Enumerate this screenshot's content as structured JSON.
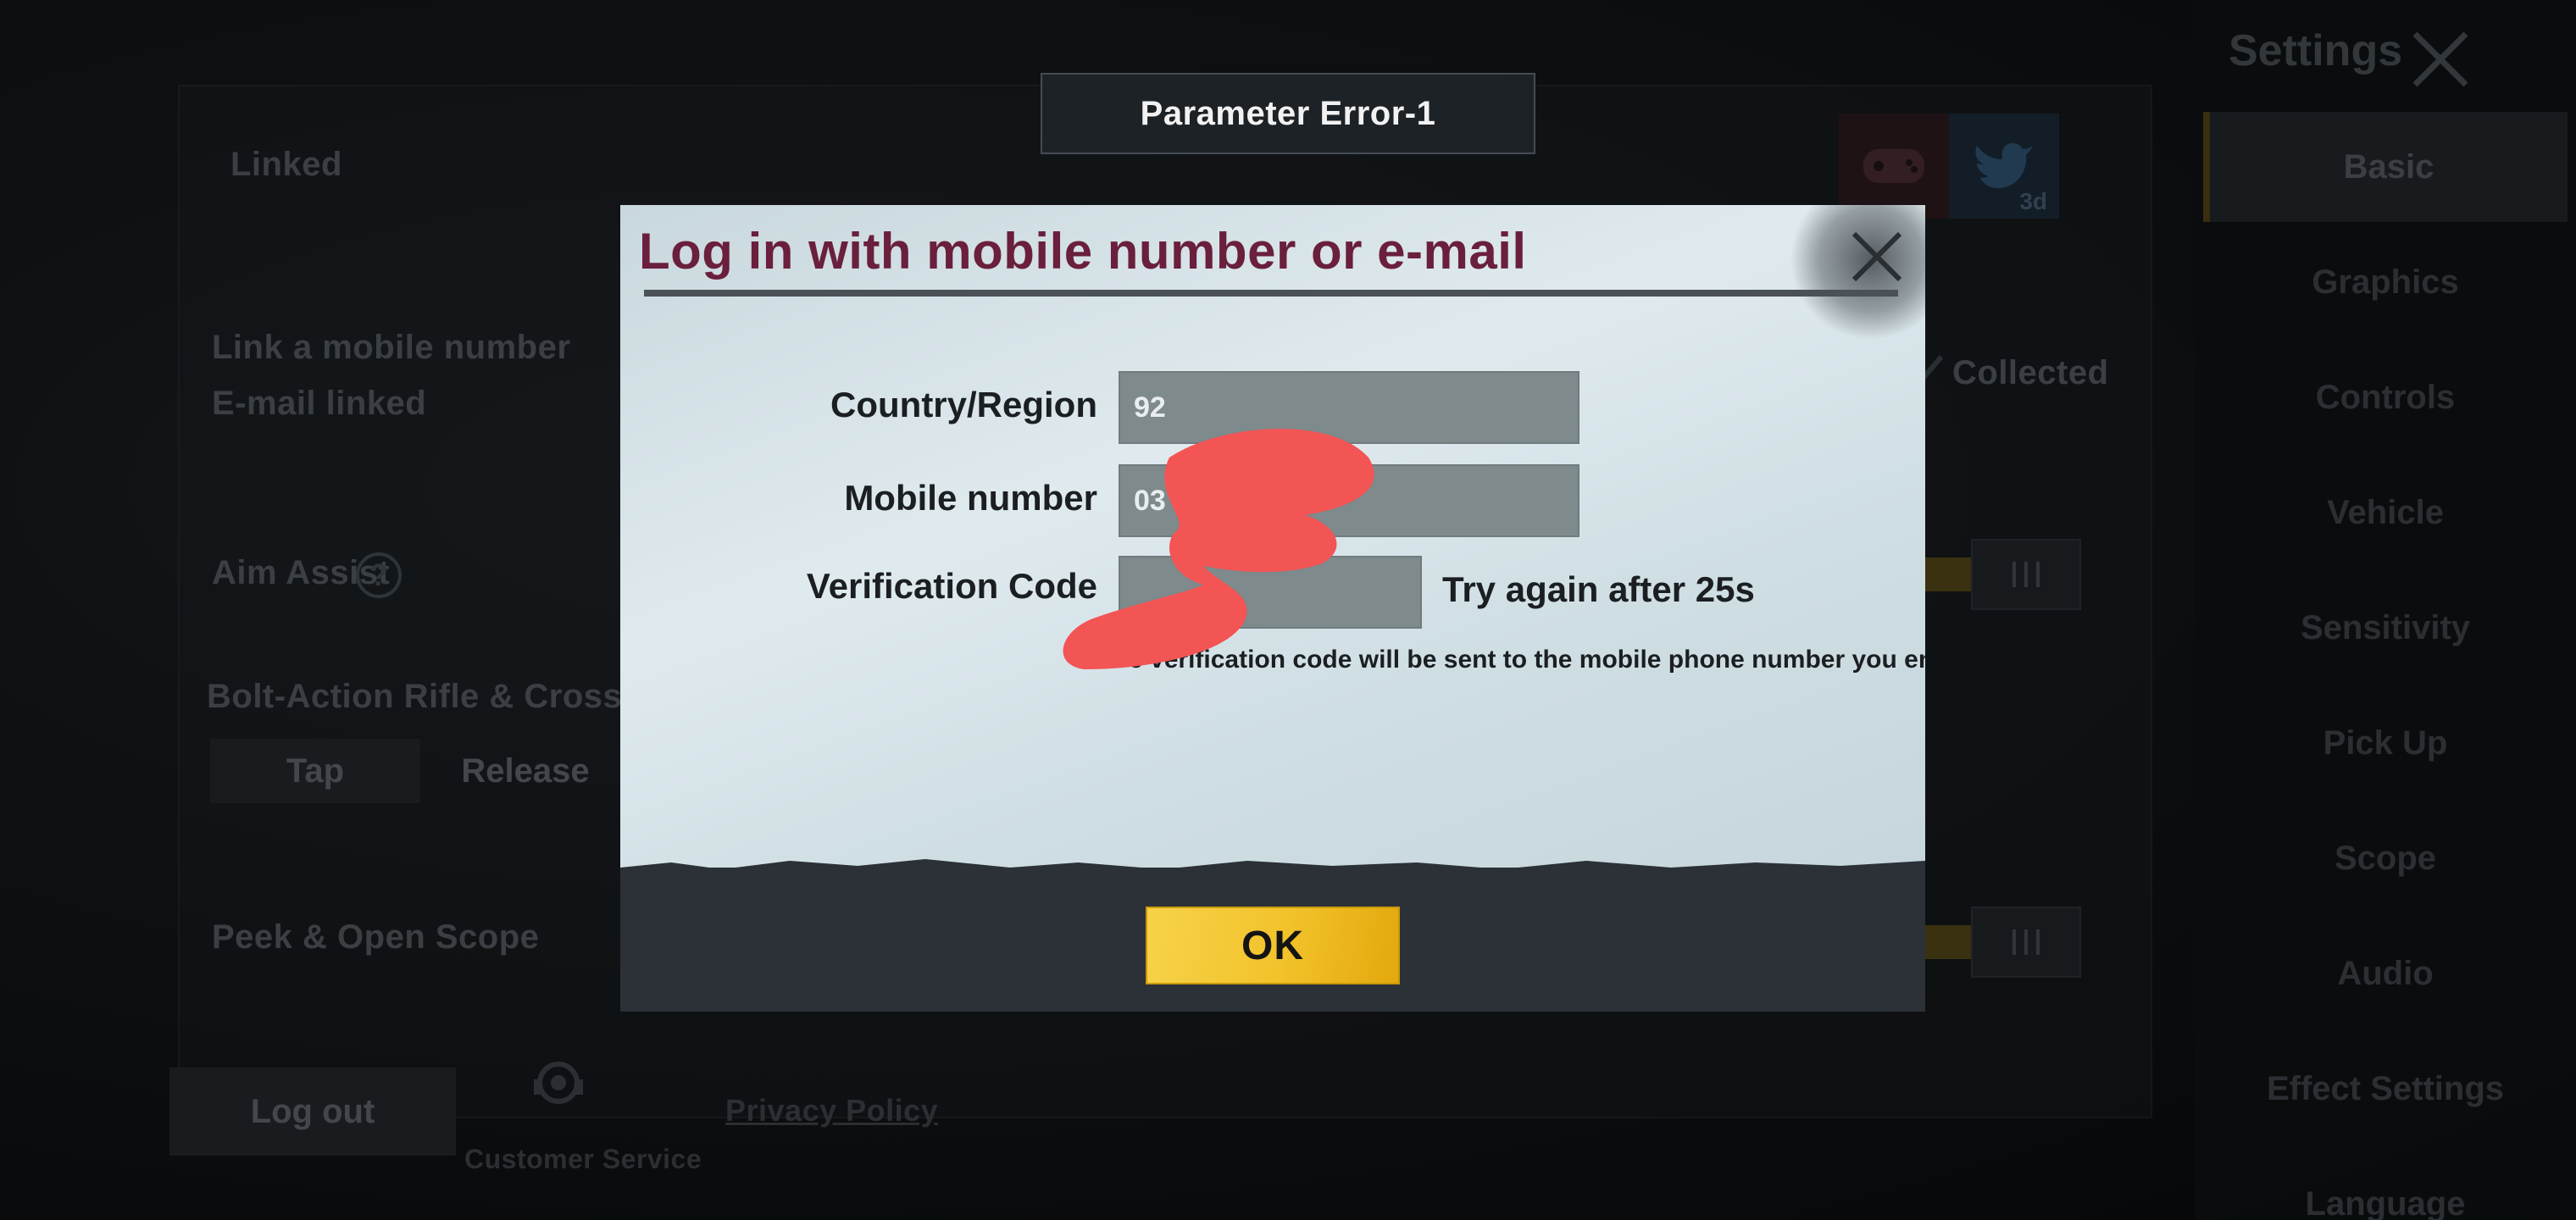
{
  "toast": {
    "text": "Parameter Error-1"
  },
  "dialog": {
    "title": "Log in with mobile number or e-mail",
    "fields": {
      "country_label": "Country/Region",
      "country_value": "92",
      "mobile_label": "Mobile number",
      "mobile_value": "03",
      "code_label": "Verification Code",
      "code_value": ""
    },
    "retry_text": "Try again after 25s",
    "hint_text": "e verification code will be sent to the mobile phone number you entered.",
    "ok_label": "OK"
  },
  "background": {
    "linked_label": "Linked",
    "link_mobile_label": "Link a mobile number",
    "email_linked_label": "E-mail linked",
    "collected_label": "Collected",
    "badge_3d": "3d",
    "aim_assist_label": "Aim Assist",
    "bolt_action_label": "Bolt-Action Rifle & Crossbow Fi",
    "tap_label": "Tap",
    "release_label": "Release",
    "peek_label": "Peek & Open Scope",
    "logout_label": "Log out",
    "customer_service_label": "Customer Service",
    "privacy_policy_label": "Privacy Policy"
  },
  "sidebar": {
    "title": "Settings",
    "items": [
      {
        "label": "Basic"
      },
      {
        "label": "Graphics"
      },
      {
        "label": "Controls"
      },
      {
        "label": "Vehicle"
      },
      {
        "label": "Sensitivity"
      },
      {
        "label": "Pick Up"
      },
      {
        "label": "Scope"
      },
      {
        "label": "Audio"
      },
      {
        "label": "Effect Settings"
      },
      {
        "label": "Language"
      }
    ]
  },
  "colors": {
    "title": "#6a1f3c",
    "ok_button": "#f2c22a",
    "field_bg": "#7e8a8c",
    "redaction": "#f35454"
  },
  "icons": [
    "close-icon",
    "customer-service-icon",
    "gamepad-icon",
    "twitter-bird-icon",
    "question-icon",
    "check-icon"
  ]
}
